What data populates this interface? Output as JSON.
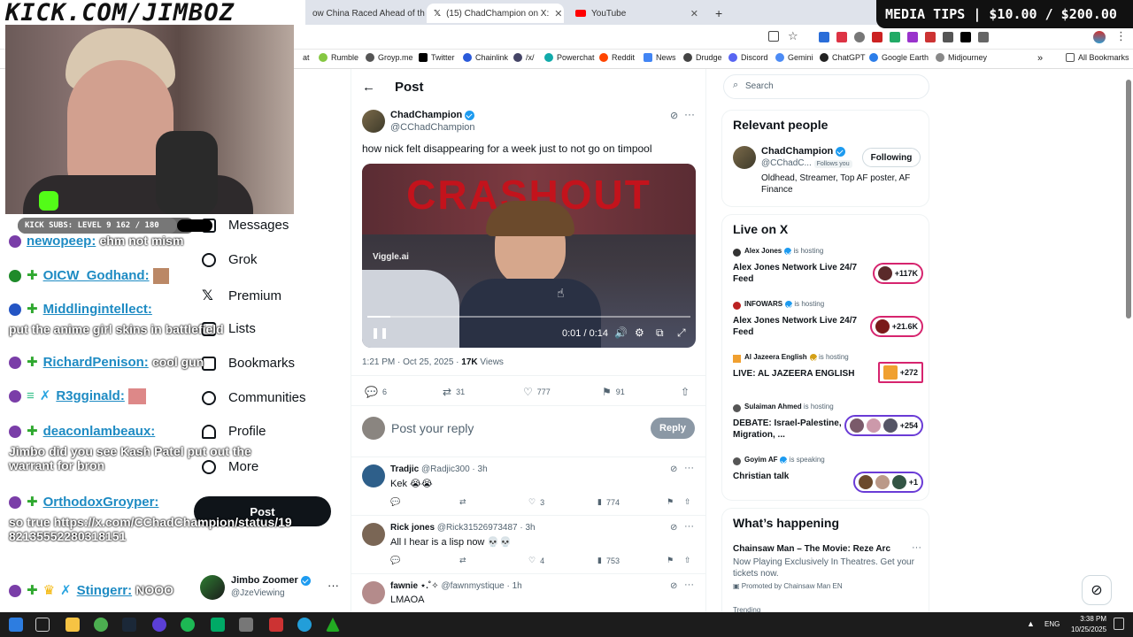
{
  "overlay": {
    "banner_left": "KICK.COM/JIMBOZ",
    "banner_right": "MEDIA TIPS | $10.00 / $200.00",
    "subs_bar": "KICK SUBS: LEVEL 9 162 / 180",
    "subs_progress": 0.9
  },
  "tabs": [
    {
      "label": "ow China Raced Ahead of the",
      "active": false
    },
    {
      "label": "(15) ChadChampion on X: ",
      "active": true
    },
    {
      "label": "YouTube",
      "active": false
    }
  ],
  "bookmarks": [
    "at",
    "Rumble",
    "Groyp.me",
    "Twitter",
    "Chainlink",
    "/x/",
    "Powerchat",
    "Reddit",
    "News",
    "Drudge",
    "Discord",
    "Gemini",
    "ChatGPT",
    "Google Earth",
    "Midjourney",
    "All Bookmarks"
  ],
  "chat": [
    {
      "user": "newopeep:",
      "text": "ehm not mism"
    },
    {
      "user": "OICW_Godhand:",
      "text": ""
    },
    {
      "user": "Middlingintellect:",
      "text": "put the anime girl skins in battlefield"
    },
    {
      "user": "RichardPenison:",
      "text": "cool gun"
    },
    {
      "user": "R3gginald:",
      "text": ""
    },
    {
      "user": "deaconlambeaux:",
      "text": "Jimbo did you see Kash Patel put out the warrant for bron"
    },
    {
      "user": "OrthodoxGroyper:",
      "text": "so true https://x.com/CChadChampion/status/1982135552280318151"
    },
    {
      "user": "Stingerr:",
      "text": "NOOO"
    }
  ],
  "nav": {
    "items": [
      "Messages",
      "Grok",
      "Premium",
      "Lists",
      "Bookmarks",
      "Communities",
      "Profile",
      "More"
    ],
    "post_button": "Post",
    "account_name": "Jimbo Zoomer",
    "account_handle": "@JzeViewing"
  },
  "post": {
    "header": "Post",
    "author": "ChadChampion",
    "handle": "@CChadChampion",
    "text": "how nick felt disappearing for a week just to not go on timpool",
    "video_title": "CRASHOUT",
    "video_watermark": "Viggle.ai",
    "video_time": "0:01 / 0:14",
    "video_progress": 0.07,
    "timestamp": "1:21 PM · Oct 25, 2025 · ",
    "views_count": "17K",
    "views_label": " Views",
    "replies": "6",
    "reposts": "31",
    "likes": "777",
    "bookmarks": "91",
    "reply_placeholder": "Post your reply",
    "reply_button": "Reply"
  },
  "replies": [
    {
      "name": "Tradjic",
      "handle": "@Radjic300 · 3h",
      "text": "Kek 😭😭",
      "likes": "3",
      "views": "774"
    },
    {
      "name": "Rick jones",
      "handle": "@Rick31526973487 · 3h",
      "text": "All I hear is a lisp now 💀💀",
      "likes": "4",
      "views": "753"
    },
    {
      "name": "fawnie ⋆.˚✧",
      "handle": "@fawnmystique · 1h",
      "text": "LMAOA",
      "likes": "",
      "views": ""
    }
  ],
  "search": {
    "placeholder": "Search"
  },
  "relevant": {
    "title": "Relevant people",
    "name": "ChadChampion",
    "handle": "@CChadC...",
    "follows_you": "Follows you",
    "button": "Following",
    "bio": "Oldhead, Streamer, Top AF poster, AF Finance"
  },
  "live": {
    "title": "Live on X",
    "items": [
      {
        "host": "Alex Jones",
        "status": "is hosting",
        "title": "Alex Jones Network Live 24/7 Feed",
        "count": "+117K"
      },
      {
        "host": "INFOWARS",
        "status": "is hosting",
        "title": "Alex Jones Network Live 24/7 Feed",
        "count": "+21.6K"
      },
      {
        "host": "Al Jazeera English",
        "status": "is hosting",
        "title": "LIVE: AL JAZEERA ENGLISH",
        "count": "+272"
      },
      {
        "host": "Sulaiman Ahmed",
        "status": "is hosting",
        "title": "DEBATE: Israel-Palestine, Migration, ...",
        "count": "+254"
      },
      {
        "host": "Goyim AF",
        "status": "is speaking",
        "title": "Christian talk",
        "count": "+1"
      }
    ]
  },
  "happening": {
    "title": "What’s happening",
    "item_title": "Chainsaw Man – The Movie: Reze Arc",
    "item_desc": "Now Playing Exclusively In Theatres. Get your tickets now.",
    "promoted": "Promoted by Chainsaw Man EN",
    "more": "Trending"
  },
  "taskbar": {
    "time": "3:38 PM",
    "date": "10/25/2025",
    "lang": "ENG"
  },
  "colors": {
    "x_blue": "#1d9bf0",
    "live_pink": "#d6246e",
    "kick_green": "#53fc18"
  }
}
